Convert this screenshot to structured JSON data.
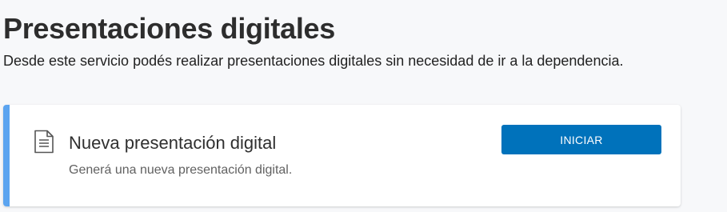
{
  "header": {
    "title": "Presentaciones digitales",
    "subtitle": "Desde este servicio podés realizar presentaciones digitales sin necesidad de ir a la dependencia."
  },
  "card": {
    "icon": "document-icon",
    "title": "Nueva presentación digital",
    "description": "Generá una nueva presentación digital.",
    "button_label": "INICIAR",
    "accent_color": "#5ba4f0",
    "button_color": "#0072bb"
  }
}
